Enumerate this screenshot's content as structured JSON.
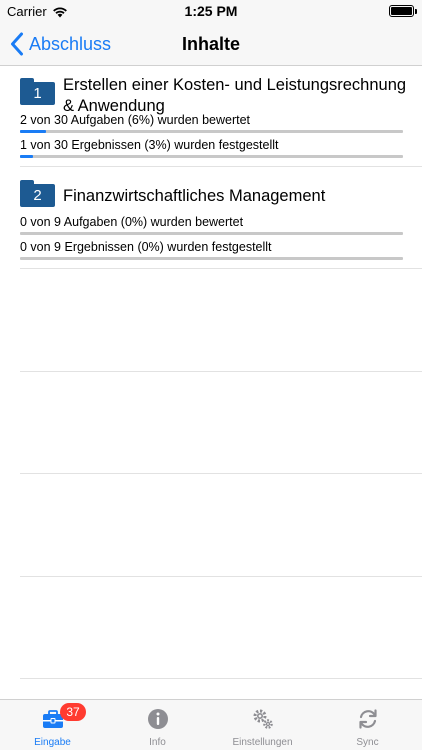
{
  "status_bar": {
    "carrier": "Carrier",
    "time": "1:25 PM"
  },
  "nav": {
    "back_label": "Abschluss",
    "title": "Inhalte"
  },
  "sections": [
    {
      "number": "1",
      "title": "Erstellen einer Kosten- und Leistungsrechnung & Anwendung",
      "tasks_text": "2 von 30 Aufgaben (6%) wurden bewertet",
      "tasks_progress": 0.0667,
      "results_text": "1 von 30 Ergebnissen (3%) wurden festgestellt",
      "results_progress": 0.0333
    },
    {
      "number": "2",
      "title": "Finanzwirtschaftliches Management",
      "tasks_text": "0 von 9 Aufgaben (0%) wurden bewertet",
      "tasks_progress": 0,
      "results_text": "0 von 9 Ergebnissen (0%) wurden festgestellt",
      "results_progress": 0
    }
  ],
  "tab_bar": {
    "tabs": [
      {
        "label": "Eingabe",
        "icon": "toolbox-icon",
        "badge": "37",
        "active": true
      },
      {
        "label": "Info",
        "icon": "info-icon",
        "active": false
      },
      {
        "label": "Einstellungen",
        "icon": "gears-icon",
        "active": false
      },
      {
        "label": "Sync",
        "icon": "sync-icon",
        "active": false
      }
    ]
  },
  "colors": {
    "accent": "#1a7cf5",
    "folder": "#1d5a92",
    "badge": "#ff3b30",
    "inactive": "#8e8e93"
  }
}
